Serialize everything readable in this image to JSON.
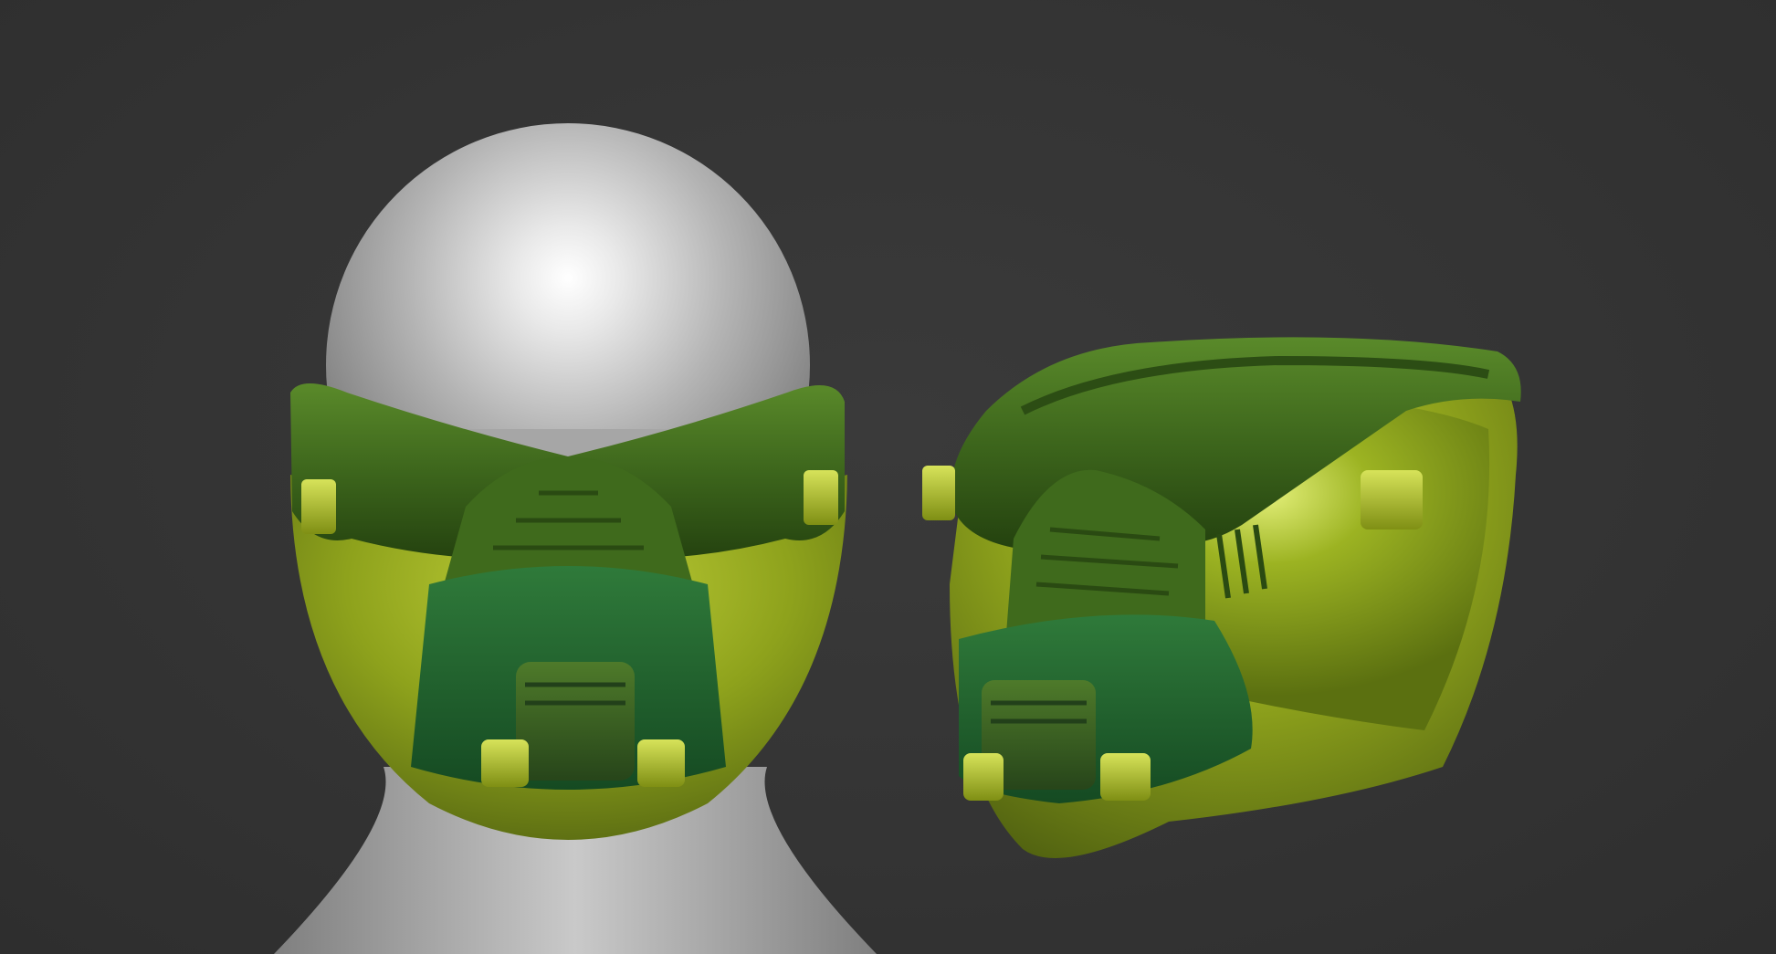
{
  "scene": {
    "background_color": "#333333",
    "objects": [
      {
        "id": "head-with-mask",
        "description_name": "front-view-head-with-mask"
      },
      {
        "id": "mask-three-quarter",
        "description_name": "three-quarter-view-mask"
      }
    ],
    "colors": {
      "skin": "#bdbdbd",
      "skin_highlight": "#ffffff",
      "mask_yellow_green": "#8fa51e",
      "mask_dark_green": "#3f6a1c",
      "mask_deep_green": "#1f5a2a",
      "clip_lime": "#b3c23a"
    }
  }
}
